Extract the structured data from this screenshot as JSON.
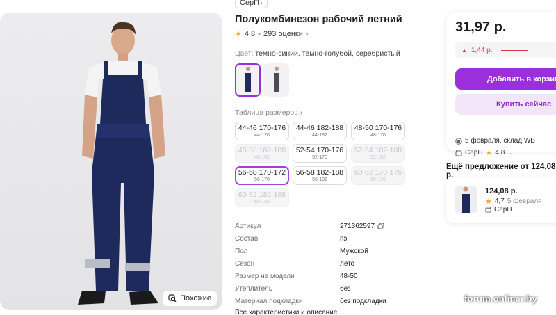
{
  "brand_tag": "СерП",
  "product": {
    "title": "Полукомбинезон рабочий летний",
    "rating": "4,8",
    "reviews": "293 оценки"
  },
  "color": {
    "label": "Цвет:",
    "value": "темно-синий, темно-голубой, серебристый"
  },
  "similar_button": "Похожие",
  "size_table_link": "Таблица размеров",
  "sizes": [
    {
      "main": "44-46 170-176",
      "sub": "44-170",
      "state": "available"
    },
    {
      "main": "44-46 182-188",
      "sub": "44-182",
      "state": "available"
    },
    {
      "main": "48-50 170-176",
      "sub": "48-170",
      "state": "available"
    },
    {
      "main": "48-50 182-188",
      "sub": "48-182",
      "state": "disabled"
    },
    {
      "main": "52-54 170-176",
      "sub": "52-170",
      "state": "available"
    },
    {
      "main": "52-54 182-188",
      "sub": "52-182",
      "state": "disabled"
    },
    {
      "main": "56-58 170-172",
      "sub": "56-170",
      "state": "selected"
    },
    {
      "main": "56-58 182-188",
      "sub": "56-182",
      "state": "available"
    },
    {
      "main": "60-62 170-176",
      "sub": "60-170",
      "state": "disabled"
    },
    {
      "main": "60-62 182-188",
      "sub": "60-182",
      "state": "disabled"
    }
  ],
  "specs": [
    {
      "label": "Артикул",
      "value": "271362597"
    },
    {
      "label": "Состав",
      "value": "пэ"
    },
    {
      "label": "Пол",
      "value": "Мужской"
    },
    {
      "label": "Сезон",
      "value": "лето"
    },
    {
      "label": "Размер на модели",
      "value": "48-50"
    },
    {
      "label": "Утеплитель",
      "value": "без"
    },
    {
      "label": "Материал подкладки",
      "value": "без подкладки"
    }
  ],
  "all_specs_link": "Все характеристики и описание",
  "price_card": {
    "price": "31,97 р.",
    "discount": "1,44 р.",
    "add_to_cart": "Добавить в корзину",
    "buy_now": "Купить сейчас",
    "delivery": "5 февраля, склад WB",
    "seller": "СерП",
    "seller_rating": "4,8"
  },
  "other_offer": {
    "title": "Ещё предложение от 124,08 р.",
    "price": "124,08 р.",
    "rating": "4,7",
    "date": "5 февраля",
    "seller": "СерП"
  },
  "watermark": "forum.onliner.by",
  "colors": {
    "accent": "#9b2fdc",
    "accent_light": "#f3e6fb",
    "discount_red": "#e0334a",
    "star": "#f5a623",
    "overall_color": "#1f2a5c"
  }
}
